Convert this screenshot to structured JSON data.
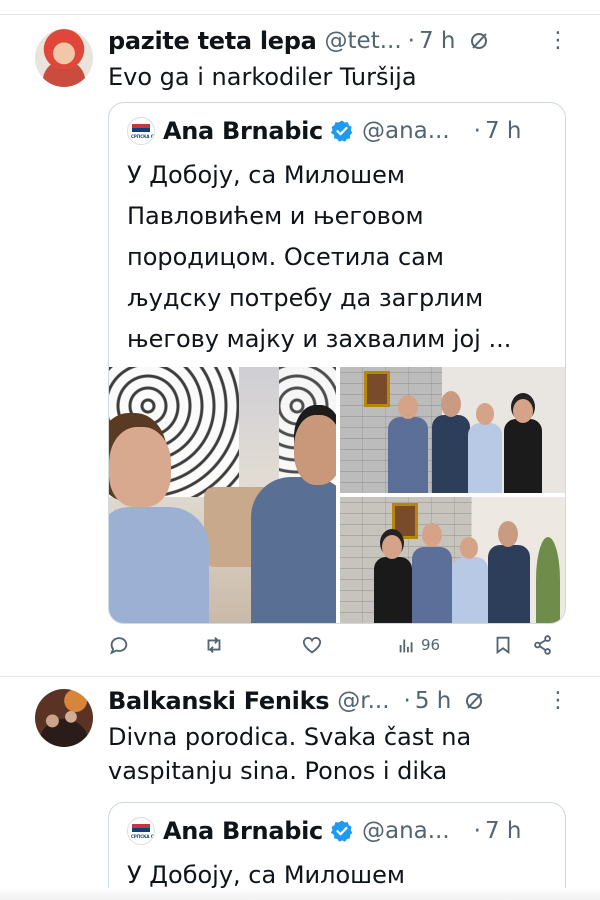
{
  "tweet1": {
    "author_name": "pazite teta lepa",
    "handle": "@tet...",
    "separator": "·",
    "time": "7 h",
    "more_label": "⋮",
    "text": "Evo ga i narkodiler Turšija",
    "quote": {
      "avatar_label": "СРПСКА СНАГА",
      "author_name": "Ana Brnabic",
      "handle": "@ana...",
      "separator": "·",
      "time": "7 h",
      "text_lines": [
        "У Добоју, са Милошем",
        "Павловићем и његовом",
        "породицом. Осетила сам",
        "људску потребу да загрлим",
        "његову мајку и захвалим јој ..."
      ]
    },
    "actions": {
      "views_count": "96"
    }
  },
  "tweet2": {
    "author_name": "Balkanski Feniks",
    "handle": "@r...",
    "separator": "·",
    "time": "5 h",
    "more_label": "⋮",
    "text_lines": [
      "Divna porodica. Svaka čast na",
      "vaspitanju sina. Ponos i dika"
    ],
    "quote": {
      "avatar_label": "СРПСКА СНАГА",
      "author_name": "Ana Brnabic",
      "handle": "@ana...",
      "separator": "·",
      "time": "7 h",
      "text_lines": [
        "У Добоју, са Милошем"
      ]
    }
  },
  "colors": {
    "text_primary": "#0f1419",
    "text_secondary": "#536471",
    "verified_blue": "#1d9bf0",
    "border": "#cfd9de"
  }
}
